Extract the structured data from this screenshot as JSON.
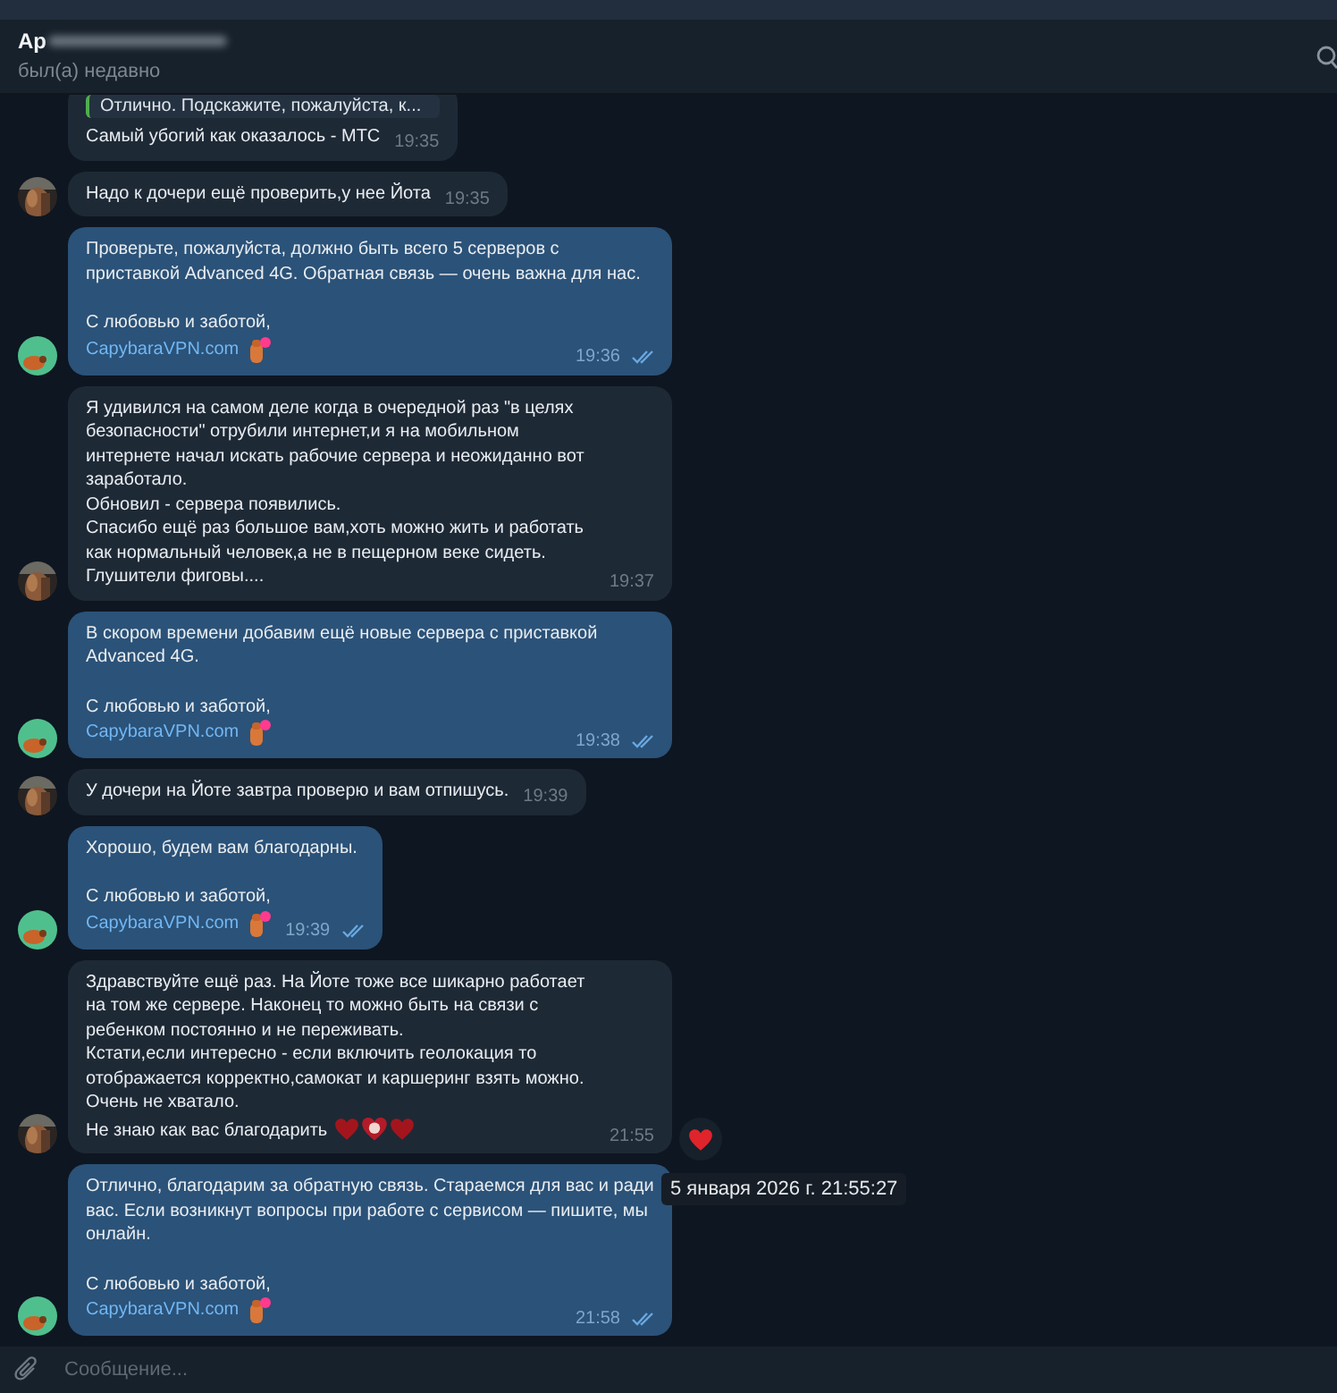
{
  "header": {
    "name": "Ар",
    "status": "был(а) недавно"
  },
  "messages": [
    {
      "kind": "in",
      "reply": "Отлично. Подскажите, пожалуйста, к...",
      "text": "Самый убогий как оказалось - МТС",
      "time": "19:35"
    },
    {
      "kind": "in",
      "text": "Надо к дочери ещё проверить,у нее Йота",
      "time": "19:35"
    },
    {
      "kind": "out",
      "text": "Проверьте, пожалуйста, должно быть всего 5 серверов с приставкой Advanced 4G. Обратная связь — очень важна для нас.",
      "signature": "С любовью и заботой,",
      "link": "CapybaraVPN.com",
      "time": "19:36",
      "read": true
    },
    {
      "kind": "in",
      "text": "Я удивился на самом деле когда в очередной раз \"в целях безопасности\" отрубили интернет,и я на мобильном интернете начал искать рабочие сервера и неожиданно вот заработало.\nОбновил - сервера появились.\nСпасибо ещё раз большое вам,хоть можно жить и работать как нормальный человек,а не в пещерном веке сидеть. Глушители фиговы....",
      "time": "19:37"
    },
    {
      "kind": "out",
      "text": "В скором времени добавим ещё новые сервера с приставкой Advanced 4G.",
      "signature": "С любовью и заботой,",
      "link": "CapybaraVPN.com",
      "time": "19:38",
      "read": true
    },
    {
      "kind": "in",
      "text": "У дочери на Йоте завтра проверю и вам отпишусь.",
      "time": "19:39"
    },
    {
      "kind": "out",
      "text": "Хорошо, будем вам благодарны.",
      "signature": "С любовью и заботой,",
      "link": "CapybaraVPN.com",
      "time": "19:39",
      "read": true
    },
    {
      "kind": "in",
      "text": "Здравствуйте ещё раз. На Йоте тоже все шикарно работает на том же сервере. Наконец то можно быть на связи с ребенком постоянно и не переживать.\nКстати,если интересно - если включить геолокация то отображается корректно,самокат и каршеринг взять можно.\nОчень не хватало.\nНе знаю как вас благодарить",
      "hearts_emoji": true,
      "time": "21:55",
      "reaction": true
    },
    {
      "kind": "out",
      "text": "Отлично, благодарим за обратную связь. Стараемся для вас и ради вас. Если возникнут вопросы при работе с сервисом — пишите, мы онлайн.",
      "signature": "С любовью и заботой,",
      "link": "CapybaraVPN.com",
      "time": "21:58",
      "read": true,
      "tooltip": "5 января 2026 г. 21:55:27"
    }
  ],
  "composer": {
    "placeholder": "Сообщение..."
  }
}
